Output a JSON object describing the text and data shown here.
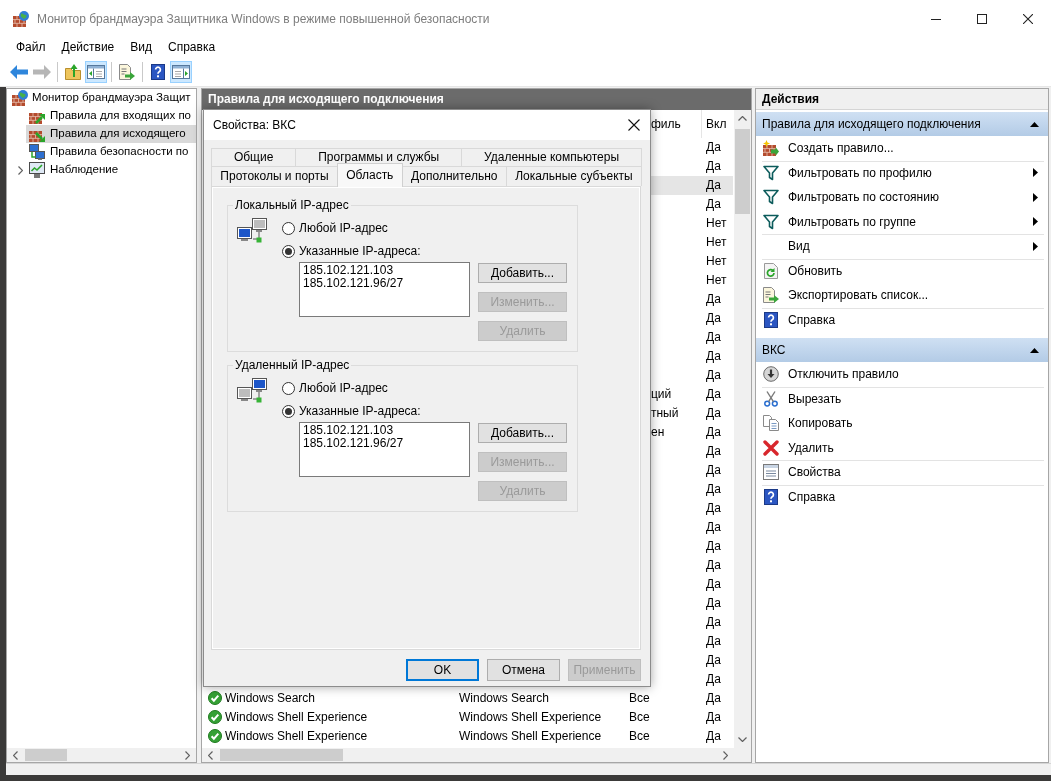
{
  "window": {
    "title": "Монитор брандмауэра Защитника Windows в режиме повышенной безопасности"
  },
  "menu": [
    "Файл",
    "Действие",
    "Вид",
    "Справка"
  ],
  "toolbar": [
    {
      "kind": "back",
      "disabled": false,
      "pressed": false
    },
    {
      "kind": "forward",
      "disabled": true,
      "pressed": false
    },
    {
      "kind": "separator"
    },
    {
      "kind": "up",
      "disabled": false,
      "pressed": false
    },
    {
      "kind": "tree-pane",
      "disabled": false,
      "pressed": true
    },
    {
      "kind": "separator"
    },
    {
      "kind": "export",
      "disabled": false,
      "pressed": false
    },
    {
      "kind": "separator"
    },
    {
      "kind": "help",
      "disabled": false,
      "pressed": false
    },
    {
      "kind": "action-pane",
      "disabled": false,
      "pressed": true
    }
  ],
  "tree": [
    {
      "kind": "root",
      "label": "Монитор брандмауэра Защит",
      "selected": false,
      "children": [
        {
          "kind": "inbound",
          "label": "Правила для входящих по",
          "selected": false
        },
        {
          "kind": "outbound",
          "label": "Правила для исходящего",
          "selected": true
        },
        {
          "kind": "security",
          "label": "Правила безопасности по",
          "selected": false
        },
        {
          "kind": "monitoring",
          "label": "Наблюдение",
          "selected": false,
          "expanded": false
        }
      ]
    }
  ],
  "rules_pane": {
    "title": "Правила для исходящего подключения",
    "columns": [
      {
        "label": "филь"
      },
      {
        "label": "Вкл"
      }
    ],
    "rows": [
      {
        "enabled": "Да",
        "selected": false
      },
      {
        "enabled": "Да",
        "selected": false
      },
      {
        "enabled": "Да",
        "selected": true
      },
      {
        "enabled": "Да",
        "selected": false
      },
      {
        "enabled": "Нет",
        "selected": false
      },
      {
        "enabled": "Нет",
        "selected": false
      },
      {
        "enabled": "Нет",
        "selected": false
      },
      {
        "enabled": "Нет",
        "selected": false
      },
      {
        "enabled": "Да",
        "selected": false
      },
      {
        "enabled": "Да",
        "selected": false
      },
      {
        "enabled": "Да",
        "selected": false
      },
      {
        "enabled": "Да",
        "selected": false
      },
      {
        "enabled": "Да",
        "selected": false
      },
      {
        "profile": "ций",
        "enabled": "Да",
        "selected": false
      },
      {
        "profile": "тный",
        "enabled": "Да",
        "selected": false
      },
      {
        "profile": "ен",
        "enabled": "Да",
        "selected": false
      },
      {
        "enabled": "Да",
        "selected": false
      },
      {
        "enabled": "Да",
        "selected": false
      },
      {
        "enabled": "Да",
        "selected": false
      },
      {
        "enabled": "Да",
        "selected": false
      },
      {
        "enabled": "Да",
        "selected": false
      },
      {
        "enabled": "Да",
        "selected": false
      },
      {
        "enabled": "Да",
        "selected": false
      },
      {
        "enabled": "Да",
        "selected": false
      },
      {
        "enabled": "Да",
        "selected": false
      },
      {
        "enabled": "Да",
        "selected": false
      },
      {
        "enabled": "Да",
        "selected": false
      },
      {
        "enabled": "Да",
        "selected": false
      },
      {
        "enabled": "Да",
        "selected": false
      },
      {
        "name": "Windows Search",
        "group": "Windows Search",
        "profile": "Все",
        "enabled": "Да",
        "selected": false
      },
      {
        "name": "Windows Shell Experience",
        "group": "Windows Shell Experience",
        "profile": "Все",
        "enabled": "Да",
        "selected": false
      },
      {
        "name": "Windows Shell Experience",
        "group": "Windows Shell Experience",
        "profile": "Все",
        "enabled": "Да",
        "selected": false
      }
    ]
  },
  "dialog": {
    "title": "Свойства: ВКС",
    "tab_rows": [
      [
        {
          "label": "Общие",
          "selected": false
        },
        {
          "label": "Программы и службы",
          "selected": false
        },
        {
          "label": "Удаленные компьютеры",
          "selected": false
        }
      ],
      [
        {
          "label": "Протоколы и порты",
          "selected": false
        },
        {
          "label": "Область",
          "selected": true
        },
        {
          "label": "Дополнительно",
          "selected": false
        },
        {
          "label": "Локальные субъекты",
          "selected": false
        }
      ]
    ],
    "groups": [
      {
        "kind": "local",
        "title": "Локальный IP-адрес",
        "options": [
          {
            "label": "Любой IP-адрес",
            "selected": false
          },
          {
            "label": "Указанные IP-адреса:",
            "selected": true
          }
        ],
        "addresses": [
          "185.102.121.103",
          "185.102.121.96/27"
        ],
        "buttons": [
          {
            "label": "Добавить...",
            "disabled": false
          },
          {
            "label": "Изменить...",
            "disabled": true
          },
          {
            "label": "Удалить",
            "disabled": true
          }
        ]
      },
      {
        "kind": "remote",
        "title": "Удаленный IP-адрес",
        "options": [
          {
            "label": "Любой IP-адрес",
            "selected": false
          },
          {
            "label": "Указанные IP-адреса:",
            "selected": true
          }
        ],
        "addresses": [
          "185.102.121.103",
          "185.102.121.96/27"
        ],
        "buttons": [
          {
            "label": "Добавить...",
            "disabled": false
          },
          {
            "label": "Изменить...",
            "disabled": true
          },
          {
            "label": "Удалить",
            "disabled": true
          }
        ]
      }
    ],
    "buttons": [
      {
        "label": "OK",
        "default": true,
        "disabled": false
      },
      {
        "label": "Отмена",
        "default": false,
        "disabled": false
      },
      {
        "label": "Применить",
        "default": false,
        "disabled": true
      }
    ]
  },
  "actions": {
    "title": "Действия",
    "sections": [
      {
        "title": "Правила для исходящего подключения",
        "expanded": true,
        "items": [
          {
            "kind": "new-rule",
            "label": "Создать правило...",
            "submenu": false
          },
          {
            "kind": "separator"
          },
          {
            "kind": "filter",
            "label": "Фильтровать по профилю",
            "submenu": true
          },
          {
            "kind": "filter",
            "label": "Фильтровать по состоянию",
            "submenu": true
          },
          {
            "kind": "filter",
            "label": "Фильтровать по группе",
            "submenu": true
          },
          {
            "kind": "separator"
          },
          {
            "kind": "view",
            "label": "Вид",
            "submenu": true
          },
          {
            "kind": "separator"
          },
          {
            "kind": "refresh",
            "label": "Обновить",
            "submenu": false
          },
          {
            "kind": "export",
            "label": "Экспортировать список...",
            "submenu": false
          },
          {
            "kind": "separator"
          },
          {
            "kind": "help",
            "label": "Справка",
            "submenu": false
          }
        ]
      },
      {
        "title": "ВКС",
        "expanded": true,
        "items": [
          {
            "kind": "disable",
            "label": "Отключить правило",
            "submenu": false
          },
          {
            "kind": "separator"
          },
          {
            "kind": "cut",
            "label": "Вырезать",
            "submenu": false
          },
          {
            "kind": "copy",
            "label": "Копировать",
            "submenu": false
          },
          {
            "kind": "delete",
            "label": "Удалить",
            "submenu": false
          },
          {
            "kind": "separator"
          },
          {
            "kind": "properties",
            "label": "Свойства",
            "submenu": false
          },
          {
            "kind": "separator"
          },
          {
            "kind": "help",
            "label": "Справка",
            "submenu": false
          }
        ]
      }
    ]
  }
}
